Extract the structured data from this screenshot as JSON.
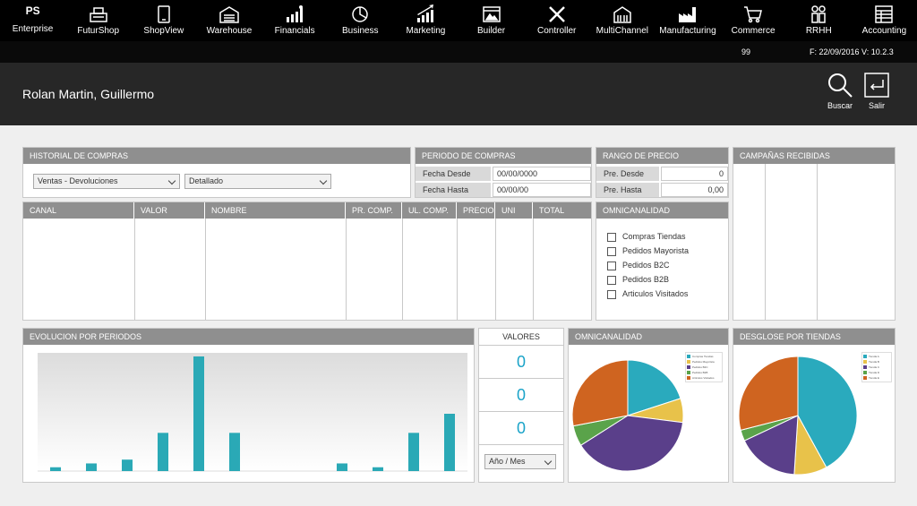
{
  "nav": {
    "enterprise": {
      "logo": "PS",
      "label": "Enterprise"
    },
    "items": [
      {
        "label": "FuturShop",
        "icon": "cash-register-icon"
      },
      {
        "label": "ShopView",
        "icon": "tablet-icon"
      },
      {
        "label": "Warehouse",
        "icon": "warehouse-icon"
      },
      {
        "label": "Financials",
        "icon": "financials-chart-icon"
      },
      {
        "label": "Business",
        "icon": "pie-chart-icon"
      },
      {
        "label": "Marketing",
        "icon": "growth-chart-icon"
      },
      {
        "label": "Builder",
        "icon": "builder-window-icon"
      },
      {
        "label": "Controller",
        "icon": "tools-icon"
      },
      {
        "label": "MultiChannel",
        "icon": "multichannel-building-icon"
      },
      {
        "label": "Manufacturing",
        "icon": "factory-icon"
      },
      {
        "label": "Commerce",
        "icon": "shopping-cart-icon"
      },
      {
        "label": "RRHH",
        "icon": "people-icon"
      },
      {
        "label": "Accounting",
        "icon": "ledger-icon"
      }
    ]
  },
  "status": {
    "count": "99",
    "version": "F: 22/09/2016 V: 10.2.3"
  },
  "header": {
    "customer_name": "Rolan Martin, Guillermo",
    "search_label": "Buscar",
    "exit_label": "Salir"
  },
  "historial": {
    "title": "HISTORIAL DE COMPRAS",
    "type_select": "Ventas - Devoluciones",
    "detail_select": "Detallado"
  },
  "periodo": {
    "title": "PERIODO DE COMPRAS",
    "from_label": "Fecha Desde",
    "from_value": "00/00/0000",
    "to_label": "Fecha Hasta",
    "to_value": "00/00/00"
  },
  "rango": {
    "title": "RANGO DE PRECIO",
    "from_label": "Pre. Desde",
    "from_value": "0",
    "to_label": "Pre. Hasta",
    "to_value": "0,00"
  },
  "campanas": {
    "title": "CAMPAÑAS RECIBIDAS"
  },
  "table": {
    "columns": [
      "CANAL",
      "VALOR",
      "NOMBRE",
      "PR. COMP.",
      "UL. COMP.",
      "PRECIO",
      "UNI",
      "TOTAL"
    ]
  },
  "omnicanalidad": {
    "title": "OMNICANALIDAD",
    "options": [
      "Compras Tiendas",
      "Pedidos Mayorista",
      "Pedidos B2C",
      "Pedidos B2B",
      "Articulos Visitados"
    ]
  },
  "evolucion": {
    "title": "EVOLUCION POR PERIODOS"
  },
  "valores": {
    "title": "VALORES",
    "values": [
      "0",
      "0",
      "0"
    ],
    "period_select": "Año / Mes"
  },
  "omni_chart": {
    "title": "OMNICANALIDAD"
  },
  "desglose": {
    "title": "DESGLOSE POR TIENDAS"
  },
  "chart_data": [
    {
      "type": "bar",
      "title": "EVOLUCION POR PERIODOS",
      "values": [
        1,
        2,
        3,
        10,
        30,
        10,
        0,
        0,
        2,
        1,
        10,
        15
      ],
      "ylim": [
        0,
        30
      ],
      "grid": false,
      "color": "#2aa9b6"
    },
    {
      "type": "pie",
      "title": "OMNICANALIDAD",
      "legend": "top-right",
      "slices": [
        {
          "label": "Compras Tiendas",
          "value": 20,
          "color": "#2aaabd"
        },
        {
          "label": "Pedidos Mayorista",
          "value": 7,
          "color": "#e8c24a"
        },
        {
          "label": "Pedidos B2C",
          "value": 39,
          "color": "#5a3f8a"
        },
        {
          "label": "Pedidos B2B",
          "value": 6,
          "color": "#5aa34a"
        },
        {
          "label": "Articulos Visitados",
          "value": 28,
          "color": "#cf6420"
        }
      ]
    },
    {
      "type": "pie",
      "title": "DESGLOSE POR TIENDAS",
      "legend": "top-right",
      "slices": [
        {
          "label": "Tienda A",
          "value": 42,
          "color": "#2aaabd"
        },
        {
          "label": "Tienda B",
          "value": 9,
          "color": "#e8c24a"
        },
        {
          "label": "Tienda C",
          "value": 17,
          "color": "#5a3f8a"
        },
        {
          "label": "Tienda D",
          "value": 3,
          "color": "#5aa34a"
        },
        {
          "label": "Tienda E",
          "value": 29,
          "color": "#cf6420"
        }
      ]
    }
  ]
}
